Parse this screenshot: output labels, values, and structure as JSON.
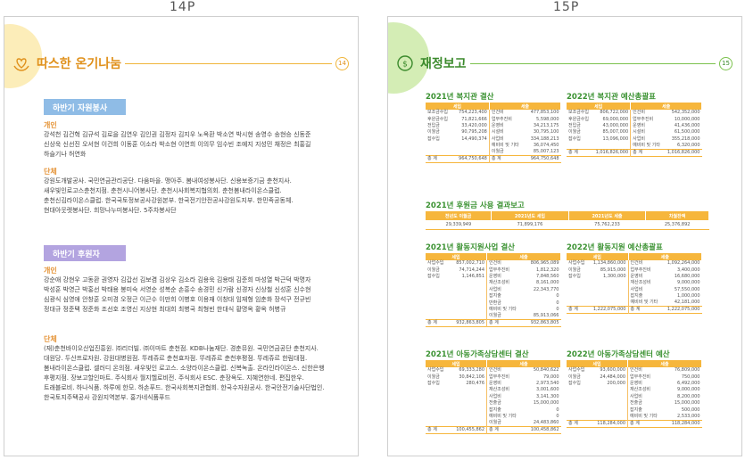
{
  "pages": [
    {
      "num": "14P"
    },
    {
      "num": "15P"
    }
  ],
  "left": {
    "title": "따스한 온기나눔",
    "page_badge": "14",
    "volunteer": {
      "banner": "하반기 자원봉사",
      "individual_label": "개인",
      "individual_text": "강석천 김건혁 김규석 김로을 김연우 김인권 김정자 김지우 노옥환 박소연 박시현 송영수 송현승 신동준 신상욱 신선진 오서현 이건희 이동훈 이소라 박소현 이연희 이의무 임수빈 조예지 지성민 채정은 최홍길 하슬기나 허연화",
      "group_label": "단체",
      "group_text": "강원도개발공사. 국민연금관리공단. 다움마을. 맹아주. 봄내여성봉사단. 신용보증기금 춘천지사. 새우빛인로고스춘천지점. 춘천시니어봉사단. 춘천시사회복지협의회. 춘천봄내라이온스클럽. 춘천신김라이온스클럽. 한국국토정보공사강원본부. 한국전기안전공사강원도지부. 한민족공동체. 현대아웃렛봉사단. 희망나누미봉사단. 5주차봉사단"
    },
    "sponsor": {
      "banner": "하반기 후원자",
      "individual_label": "개인",
      "individual_text": "강순애 강현우 고동환 권영자 김갑선 김보겸 김상우 김소라 김용욱 김용태 김준희 마성열 박근덕 박명자 박성훈 박영근 박홍선 박태용 봉미숙 서영순 성복순 손흥수 송경민 신가람 신경자 신상철 신성훈 신수현 심광식 심영애 안창훈 오미경 오정근 이근수 이만희 이병호 이용재 이창대 임재형 임춘화 장석구 전규빈 정대규 정준택 정준화 조선호 조영신 지상현 최대희 최병국 최형빈 한대식 황명옥 황옥 허병규",
      "group_label": "단체",
      "group_text": "(재)춘천바이오산업진흥원. ㈜리더빌. ㈜이마트 춘천점. KDB나눔재단. 경춘뮤원. 국민연금공단 춘천지사. 대원당. 두산프로자원. 강원대병원점. 뚜레쥬르 춘천효자점. 뚜레쥬르 춘천후평점. 뚜레쥬르 한림대점. 봄내라이온스클럽. 셀러디 온의점. 새우빛인 로고스. 소양라이온스클럽. 신복녹출. 온라인라이온스. 신한은행 후평지점. 장보고할인마트. 주식회사 월지헬로비전. 주식회사 ESC. 춘장옥도. 지혜연한네. 편집한우. 트래블로비. 하나식품. 하루에 한모. 하손푸드. 한국사회복지관협회. 한국수자원공사. 한국안전기술사단법인. 한국토지주택공사 강원지역본부. 홍가네식품푸드"
    }
  },
  "right": {
    "title": "재정보고",
    "page_badge": "15",
    "tables": [
      {
        "title": "2021년 복지관 결산",
        "head": [
          "세입",
          "세출"
        ],
        "rows": [
          [
            "보조금수입",
            "754,223,400",
            "인건비",
            "477,853,100"
          ],
          [
            "후원금수입",
            "71,821,666",
            "업무추진비",
            "5,598,000"
          ],
          [
            "전입금",
            "33,420,000",
            "운영비",
            "34,213,175"
          ],
          [
            "이월금",
            "90,795,208",
            "시설비",
            "30,795,100"
          ],
          [
            "잡수입",
            "14,490,374",
            "사업비",
            "334,188,213"
          ],
          [
            "",
            "",
            "예비비 및 기타",
            "36,074,450"
          ],
          [
            "",
            "",
            "이월금",
            "85,007,123"
          ]
        ],
        "total": [
          "총 계",
          "964,750,648",
          "총 계",
          "964,750,648"
        ]
      },
      {
        "title": "2022년 복지관 예산총괄표",
        "head": [
          "세입",
          "세출"
        ],
        "rows": [
          [
            "보조금수입",
            "806,722,000",
            "인건비",
            "542,352,000"
          ],
          [
            "후원금수입",
            "69,000,000",
            "업무추진비",
            "10,000,000"
          ],
          [
            "전입금",
            "43,000,000",
            "운영비",
            "41,436,000"
          ],
          [
            "이월금",
            "85,007,000",
            "시설비",
            "61,500,000"
          ],
          [
            "잡수입",
            "13,096,000",
            "사업비",
            "355,218,000"
          ],
          [
            "",
            "",
            "예비비 및 기타",
            "6,320,000"
          ]
        ],
        "total": [
          "총 계",
          "1,016,826,000",
          "총 계",
          "1,016,826,000"
        ]
      },
      {
        "title": "2021년 활동지원사업 결산",
        "head": [
          "세입",
          "세출"
        ],
        "rows": [
          [
            "사업수입",
            "857,002,710",
            "인건비",
            "806,965,089"
          ],
          [
            "이월금",
            "74,714,244",
            "업무추진비",
            "1,812,320"
          ],
          [
            "잡수입",
            "1,146,851",
            "운영비",
            "7,848,560"
          ],
          [
            "",
            "",
            "재산조성비",
            "8,161,000"
          ],
          [
            "",
            "",
            "사업비",
            "22,343,770"
          ],
          [
            "",
            "",
            "잡지출",
            "0"
          ],
          [
            "",
            "",
            "반환금",
            "0"
          ],
          [
            "",
            "",
            "예비비 및 기타",
            "0"
          ],
          [
            "",
            "",
            "이월금",
            "85,913,066"
          ]
        ],
        "total": [
          "총 계",
          "932,863,805",
          "총 계",
          "932,863,805"
        ]
      },
      {
        "title": "2022년 활동지원 예산총괄표",
        "head": [
          "세입",
          "세출"
        ],
        "rows": [
          [
            "사업수입",
            "1,134,860,000",
            "인건비",
            "1,092,264,000"
          ],
          [
            "이월금",
            "85,915,000",
            "업무추진비",
            "3,400,000"
          ],
          [
            "잡수입",
            "1,300,000",
            "운영비",
            "16,680,000"
          ],
          [
            "",
            "",
            "재산조성비",
            "9,000,000"
          ],
          [
            "",
            "",
            "사업비",
            "57,550,000"
          ],
          [
            "",
            "",
            "잡지출",
            "1,000,000"
          ],
          [
            "",
            "",
            "예비비 및 기타",
            "42,181,000"
          ]
        ],
        "total": [
          "총 계",
          "1,222,075,000",
          "총 계",
          "1,222,075,000"
        ]
      },
      {
        "title": "2021년 아동가족상담센터 결산",
        "head": [
          "세입",
          "세출"
        ],
        "rows": [
          [
            "사업수입",
            "69,333,280",
            "인건비",
            "50,840,622"
          ],
          [
            "이월금",
            "30,842,106",
            "업무추진비",
            "79,000"
          ],
          [
            "잡수입",
            "280,476",
            "운영비",
            "2,973,540"
          ],
          [
            "",
            "",
            "재산조성비",
            "3,001,600"
          ],
          [
            "",
            "",
            "사업비",
            "3,141,300"
          ],
          [
            "",
            "",
            "전출금",
            "15,000,000"
          ],
          [
            "",
            "",
            "잡지출",
            "0"
          ],
          [
            "",
            "",
            "예비비 및 기타",
            "0"
          ],
          [
            "",
            "",
            "이월금",
            "24,483,860"
          ]
        ],
        "total": [
          "총 계",
          "100,455,862",
          "총 계",
          "100,458,862"
        ]
      },
      {
        "title": "2022년 아동가족상담센터 예산",
        "head": [
          "세입",
          "세출"
        ],
        "rows": [
          [
            "사업수입",
            "93,600,000",
            "인건비",
            "76,809,000"
          ],
          [
            "이월금",
            "24,484,000",
            "업무추진비",
            "750,000"
          ],
          [
            "잡수입",
            "200,000",
            "운영비",
            "6,492,000"
          ],
          [
            "",
            "",
            "재산조성비",
            "9,000,000"
          ],
          [
            "",
            "",
            "사업비",
            "8,200,000"
          ],
          [
            "",
            "",
            "전출금",
            "15,000,000"
          ],
          [
            "",
            "",
            "잡지출",
            "500,000"
          ],
          [
            "",
            "",
            "예비비 및 기타",
            "2,533,000"
          ]
        ],
        "total": [
          "총 계",
          "118,284,000",
          "총 계",
          "118,284,000"
        ]
      }
    ],
    "sponsor_usage": {
      "title": "2021년 후원금 사용 결과보고",
      "head": [
        "전년도 이월금",
        "2021년도 세입",
        "2021년도 세출",
        "차월잔액"
      ],
      "values": [
        "29,339,949",
        "71,899,176",
        "75,762,233",
        "25,376,892"
      ]
    }
  },
  "colors": {
    "orange": "#f6b63c",
    "green": "#3b9232",
    "blue_banner": "#8fbce6",
    "purple_banner": "#b3a4e0"
  }
}
